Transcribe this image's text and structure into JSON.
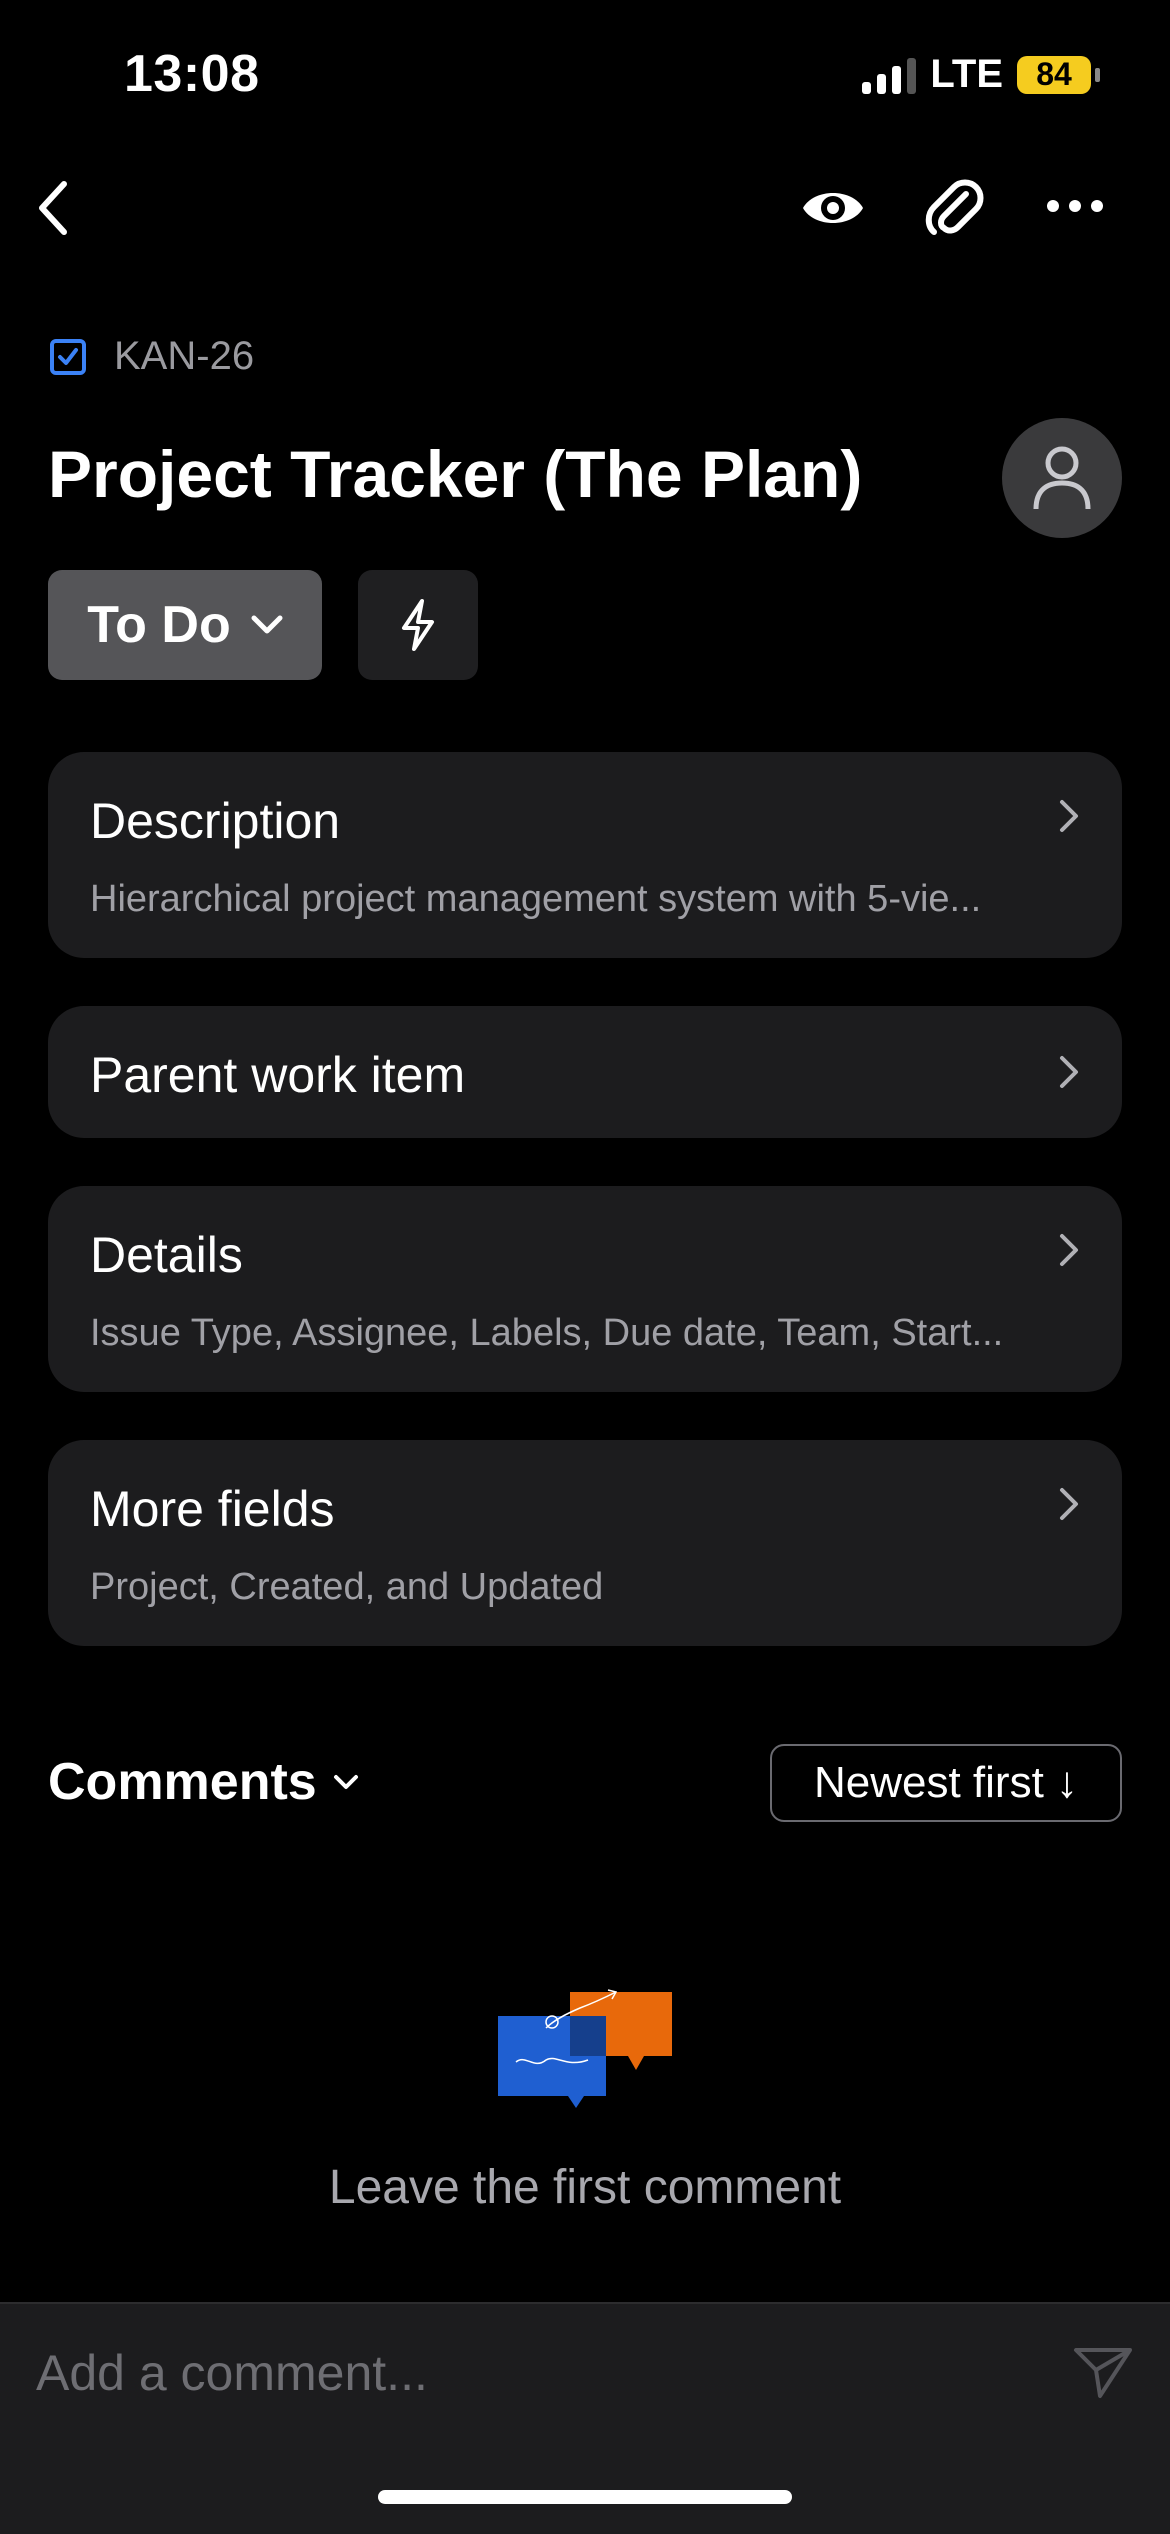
{
  "status_bar": {
    "time": "13:08",
    "network": "LTE",
    "battery": "84"
  },
  "issue": {
    "key": "KAN-26",
    "title": "Project Tracker (The Plan)",
    "status": "To Do"
  },
  "sections": {
    "description": {
      "title": "Description",
      "subtitle": "Hierarchical project management system with 5-vie..."
    },
    "parent": {
      "title": "Parent work item"
    },
    "details": {
      "title": "Details",
      "subtitle": "Issue Type, Assignee, Labels, Due date, Team, Start..."
    },
    "more_fields": {
      "title": "More fields",
      "subtitle": "Project, Created, and Updated"
    }
  },
  "comments": {
    "label": "Comments",
    "sort": "Newest first ↓",
    "empty_text": "Leave the first comment",
    "placeholder": "Add a comment..."
  },
  "colors": {
    "accent_blue": "#3b82f6",
    "battery": "#f5cc1f",
    "card_bg": "#1c1c1e",
    "illus_orange": "#e8690b",
    "illus_blue": "#1f5fd1"
  },
  "icons": [
    "back-chevron-icon",
    "eye-icon",
    "paperclip-icon",
    "more-icon",
    "checkbox-icon",
    "user-icon",
    "chevron-down-icon",
    "bolt-icon",
    "chevron-right-icon",
    "send-icon"
  ]
}
